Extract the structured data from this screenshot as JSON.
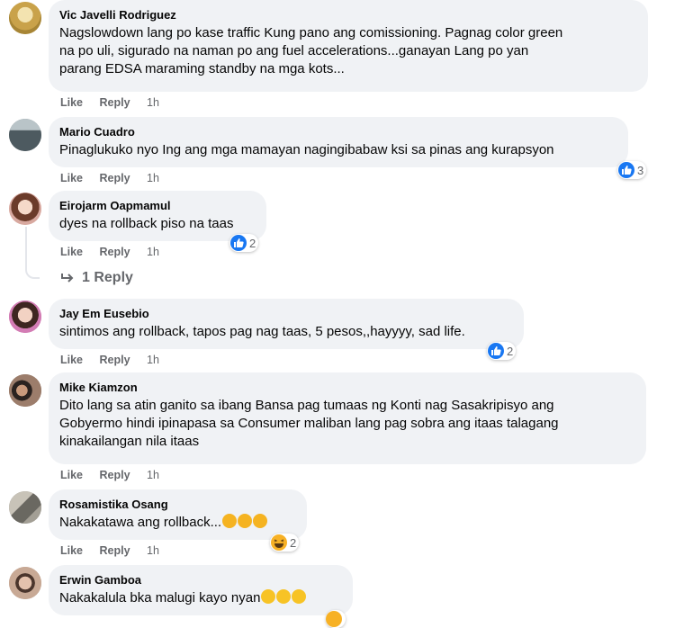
{
  "actions": {
    "like": "Like",
    "reply": "Reply"
  },
  "comments": [
    {
      "author": "Vic Javelli Rodriguez",
      "text": [
        "Nagslowdown lang po kase traffic Kung pano ang comissioning. Pagnag color green",
        "na po uli, sigurado na naman po ang fuel accelerations...ganayan Lang po yan",
        "parang EDSA maraming standby na mga kots..."
      ],
      "time": "1h"
    },
    {
      "author": "Mario Cuadro",
      "text": [
        "Pinaglukuko nyo Ing ang mga mamayan nagingibabaw ksi sa pinas ang kurapsyon"
      ],
      "time": "1h",
      "reactions": "3"
    },
    {
      "author": "Eirojarm Oapmamul",
      "text": [
        "dyes na rollback piso na taas"
      ],
      "time": "1h",
      "reactions": "2",
      "replies": "1 Reply"
    },
    {
      "author": "Jay Em Eusebio",
      "text": [
        "sintimos ang rollback, tapos pag nag taas, 5 pesos,,hayyyy, sad life."
      ],
      "time": "1h",
      "reactions": "2"
    },
    {
      "author": "Mike Kiamzon",
      "text": [
        "Dito lang sa atin ganito sa ibang Bansa pag tumaas ng Konti nag Sasakripisyo ang",
        "Gobyermo hindi ipinapasa sa Consumer maliban lang pag sobra ang itaas talagang",
        "kinakailangan nila itaas"
      ],
      "time": "1h"
    },
    {
      "author": "Rosamistika Osang",
      "text": [
        "Nakakatawa ang rollback..."
      ],
      "time": "1h",
      "reactions": "2"
    },
    {
      "author": "Erwin Gamboa",
      "text": [
        "Nakakalula bka malugi kayo nyan"
      ],
      "time": ""
    }
  ]
}
